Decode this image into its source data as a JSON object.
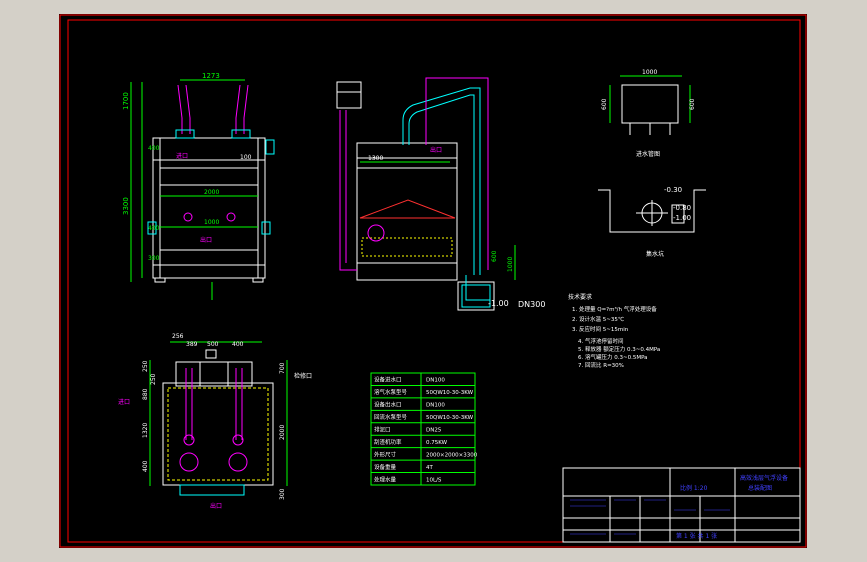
{
  "colors": {
    "frame_bg": "#d4d0c8",
    "drawing_bg": "#000000",
    "border": "#ff0000",
    "dim": "#00ff00",
    "tank": "#ffffff",
    "pipe": "#ff00ff",
    "cyan": "#00ffff",
    "yellow": "#ffff00",
    "blue": "#4040ff"
  },
  "front_view": {
    "top_width": "1273",
    "height_total": "3300",
    "height_top": "1700",
    "height_400a": "400",
    "height_400b": "400",
    "height_300": "300",
    "label_100": "100",
    "label_2000": "2000",
    "label_1000": "1000",
    "inlet_label": "进口",
    "outlet_label": "出口"
  },
  "side_view": {
    "label_1300": "1300",
    "level_label": "-1.00",
    "dn_label": "DN300",
    "outlet_label": "出口",
    "right_dim": "1000",
    "right_dim2": "600"
  },
  "top_view": {
    "dims_top": [
      "256",
      "389",
      "500",
      "400"
    ],
    "dims_left": [
      "250",
      "250",
      "880",
      "1320",
      "400"
    ],
    "dims_right": [
      "700",
      "2000",
      "300"
    ],
    "inlet_label": "进口",
    "outlet_label": "出口",
    "side_label": "检修口"
  },
  "detail_top_right": {
    "width": "1000",
    "height_left": "600",
    "height_right": "600",
    "caption": "进水管图"
  },
  "detail_pit": {
    "levels": [
      "-0.30",
      "-0.80",
      "-1.00"
    ],
    "caption": "集水坑"
  },
  "notes": {
    "title": "技术要求",
    "lines": [
      "1. 处理量 Q=?m³/h 气浮处理设备",
      "2. 设计水温 5~35℃",
      "3. 反应时间 5~15min",
      "4. 气浮池停留时间",
      "5. 释放器 额定压力 0.3~0.4MPa",
      "6. 溶气罐压力 0.3~0.5MPa",
      "7. 回流比 R=30%"
    ]
  },
  "params_table": {
    "rows": [
      [
        "设备进水口",
        "DN100"
      ],
      [
        "溶气水泵型号",
        "50QW10-30-3KW"
      ],
      [
        "设备出水口",
        "DN100"
      ],
      [
        "回流水泵型号",
        "50QW10-30-3KW"
      ],
      [
        "排泥口",
        "DN25"
      ],
      [
        "刮渣机功率",
        "0.75KW"
      ],
      [
        "外形尺寸",
        "2000×2000×3300"
      ],
      [
        "设备重量",
        "4T"
      ],
      [
        "处理水量",
        "10L/S"
      ]
    ]
  },
  "title_block": {
    "project": "高效浅层气浮设备",
    "drawing": "总装配图",
    "scale_text": "比例 1:20",
    "sheet": "第 1 张 共 1 张"
  }
}
